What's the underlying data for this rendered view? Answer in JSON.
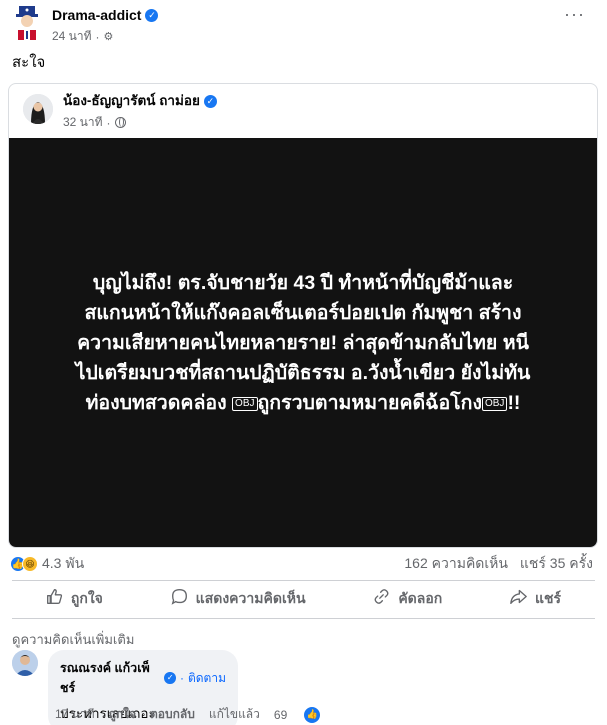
{
  "post": {
    "author": "Drama-addict",
    "time": "24 นาที",
    "text": "สะใจ"
  },
  "shared": {
    "author": "น้อง-ธัญญารัตน์ ถาม่อย",
    "time": "32 นาที",
    "headline_lines": [
      "บุญไม่ถึง! ตร.จับชายวัย 43 ปี ทำหน้าที่บัญชีม้าและ",
      "สแกนหน้าให้แก๊งคอลเซ็นเตอร์ปอยเปต กัมพูชา สร้าง",
      "ความเสียหายคนไทยหลายราย! ล่าสุดข้ามกลับไทย หนี",
      "ไปเตรียมบวชที่สถานปฏิบัติธรรม อ.วังน้ำเขียว ยังไม่ทัน"
    ],
    "headline_last_pre": "ท่องบทสวดคล่อง ",
    "obj_tag": "OBJ",
    "headline_last_mid": "ถูกรวบตามหมายคดีฉ้อโกง",
    "headline_last_post": "!!"
  },
  "stats": {
    "reaction_count": "4.3 พัน",
    "comments": "162 ความคิดเห็น",
    "shares": "แชร์ 35 ครั้ง"
  },
  "actions": {
    "like": "ถูกใจ",
    "comment": "แสดงความคิดเห็น",
    "copy": "คัดลอก",
    "share": "แชร์"
  },
  "comments_section": {
    "more_label": "ดูความคิดเห็นเพิ่มเติม",
    "comment": {
      "author": "รณณรงค์ แก้วเพ็ชร์",
      "follow": "ติดตาม",
      "text": "ประหารเลยเถอะ",
      "time": "17 นาที",
      "like": "ถูกใจ",
      "reply": "ตอบกลับ",
      "edited": "แก้ไขแล้ว",
      "like_count": "69"
    }
  },
  "colors": {
    "accent": "#1877f2",
    "image_bg": "#121212",
    "muted": "#65676b"
  },
  "icons": {
    "more": "more-horizontal-icon",
    "privacy_post": "gear-icon",
    "privacy_shared": "globe-icon",
    "like": "thumbs-up-icon",
    "comment": "speech-bubble-icon",
    "copy": "copy-icon",
    "share": "share-arrow-icon"
  }
}
